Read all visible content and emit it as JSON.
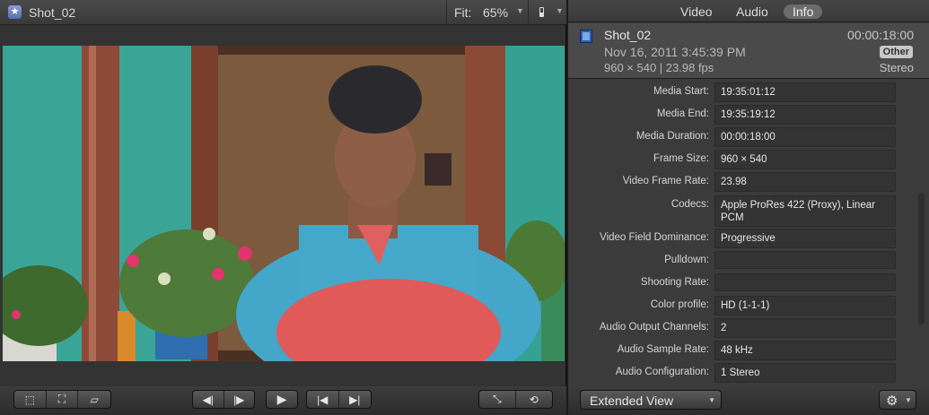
{
  "viewer": {
    "clip_name": "Shot_02",
    "fit_label": "Fit:",
    "fit_value": "65%"
  },
  "inspector": {
    "tabs": [
      "Video",
      "Audio",
      "Info"
    ],
    "active_tab": "Info",
    "header": {
      "clip_name": "Shot_02",
      "duration": "00:00:18:00",
      "date": "Nov 16, 2011 3:45:39 PM",
      "badge": "Other",
      "format": "960 × 540 | 23.98 fps",
      "audio": "Stereo"
    },
    "properties": [
      {
        "label": "Media Start:",
        "value": "19:35:01:12"
      },
      {
        "label": "Media End:",
        "value": "19:35:19:12"
      },
      {
        "label": "Media Duration:",
        "value": "00:00:18:00"
      },
      {
        "label": "Frame Size:",
        "value": "960 × 540"
      },
      {
        "label": "Video Frame Rate:",
        "value": "23.98"
      },
      {
        "label": "Codecs:",
        "value": "Apple ProRes 422 (Proxy), Linear PCM"
      },
      {
        "label": "Video Field Dominance:",
        "value": "Progressive"
      },
      {
        "label": "Pulldown:",
        "value": ""
      },
      {
        "label": "Shooting Rate:",
        "value": ""
      },
      {
        "label": "Color profile:",
        "value": "HD (1-1-1)"
      },
      {
        "label": "Audio Output Channels:",
        "value": "2"
      },
      {
        "label": "Audio Sample Rate:",
        "value": "48 kHz"
      },
      {
        "label": "Audio Configuration:",
        "value": "1 Stereo"
      }
    ],
    "view_select": "Extended View"
  }
}
